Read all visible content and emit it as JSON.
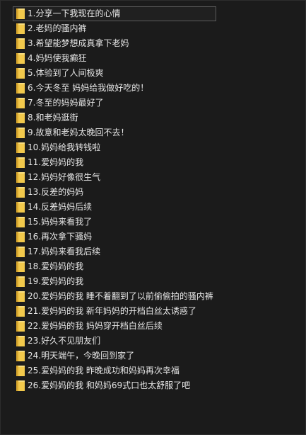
{
  "colors": {
    "background": "#1b1b1b",
    "text": "#e6e6e6",
    "folder": "#f2c94c",
    "selection_border": "#5c5c5c"
  },
  "icon": "folder-icon",
  "items": [
    {
      "label": "1.分享一下我现在的心情",
      "selected": true
    },
    {
      "label": "2.老妈的骚内裤"
    },
    {
      "label": "3.希望能梦想成真拿下老妈"
    },
    {
      "label": "4.妈妈使我癫狂"
    },
    {
      "label": "5.体验到了人间极爽"
    },
    {
      "label": "6.今天冬至 妈妈给我做好吃的！"
    },
    {
      "label": "7.冬至的妈妈最好了"
    },
    {
      "label": "8.和老妈逛街"
    },
    {
      "label": "9.故意和老妈太晚回不去！"
    },
    {
      "label": "10.妈妈给我转钱啦"
    },
    {
      "label": "11.爱妈妈的我"
    },
    {
      "label": "12.妈妈好像很生气"
    },
    {
      "label": "13.反差的妈妈"
    },
    {
      "label": "14.反差妈妈后续"
    },
    {
      "label": "15.妈妈来看我了"
    },
    {
      "label": "16.再次拿下骚妈"
    },
    {
      "label": "17.妈妈来看我后续"
    },
    {
      "label": "18.爱妈妈的我"
    },
    {
      "label": "19.爱妈妈的我"
    },
    {
      "label": "20.爱妈妈的我 睡不着翻到了以前偷偷拍的骚内裤"
    },
    {
      "label": "21.爱妈妈的我 新年妈妈的开档白丝太诱惑了"
    },
    {
      "label": "22.爱妈妈的我 妈妈穿开档白丝后续"
    },
    {
      "label": "23.好久不见朋友们"
    },
    {
      "label": "24.明天端午，今晚回到家了"
    },
    {
      "label": "25.爱妈妈的我 昨晚成功和妈妈再次幸福"
    },
    {
      "label": "26.爱妈妈的我 和妈妈69式口也太舒服了吧"
    }
  ]
}
